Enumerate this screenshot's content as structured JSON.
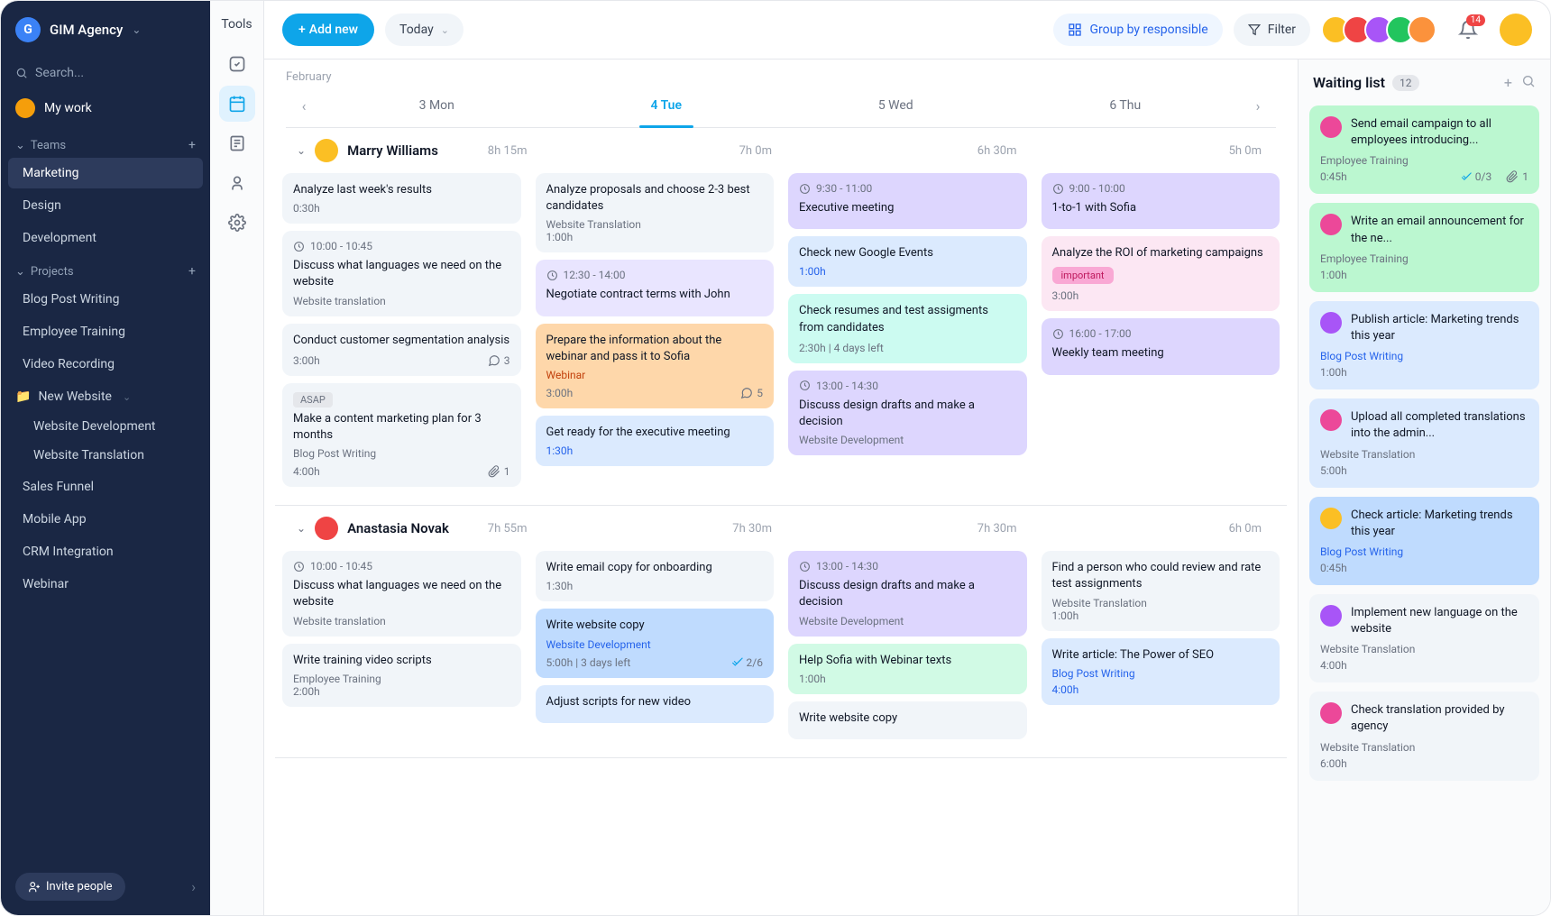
{
  "sidebar": {
    "workspace": "GIM Agency",
    "search_placeholder": "Search...",
    "my_work": "My work",
    "teams_label": "Teams",
    "teams": [
      "Marketing",
      "Design",
      "Development"
    ],
    "projects_label": "Projects",
    "projects_flat": [
      "Blog Post Writing",
      "Employee Training",
      "Video Recording"
    ],
    "project_folder": "New Website",
    "project_sub": [
      "Website Development",
      "Website Translation"
    ],
    "projects_rest": [
      "Sales Funnel",
      "Mobile App",
      "CRM Integration",
      "Webinar"
    ],
    "invite": "Invite people"
  },
  "toolbar": {
    "tools": "Tools",
    "add_new": "Add new",
    "today": "Today",
    "group_by": "Group by responsible",
    "filter": "Filter",
    "notif_count": "14"
  },
  "calendar": {
    "month": "February",
    "days": [
      "3 Mon",
      "4 Tue",
      "5 Wed",
      "6 Thu"
    ],
    "active_index": 1
  },
  "people": [
    {
      "name": "Marry Williams",
      "avatar_color": "#fbbf24",
      "durations": [
        "8h 15m",
        "7h 0m",
        "6h 30m",
        "5h 0m"
      ],
      "cols": [
        [
          {
            "type": "gray",
            "title": "Analyze last week's results",
            "dur": "0:30h"
          },
          {
            "type": "gray",
            "time": "10:00 - 10:45",
            "title": "Discuss what languages we need on the website",
            "proj": "Website translation"
          },
          {
            "type": "gray",
            "title": "Conduct customer segmentation analysis",
            "foot_l": "3:00h",
            "foot_r": "3",
            "foot_icon": "comment"
          },
          {
            "type": "gray",
            "badge": "ASAP",
            "title": "Make a content marketing plan for 3 months",
            "proj": "Blog Post Writing",
            "foot_l": "4:00h",
            "foot_r": "1",
            "foot_icon": "attach"
          }
        ],
        [
          {
            "type": "gray",
            "title": "Analyze proposals and choose 2-3 best candidates",
            "proj": "Website Translation",
            "dur": "1:00h"
          },
          {
            "type": "purple-l",
            "time": "12:30 - 14:00",
            "title": "Negotiate contract terms with John"
          },
          {
            "type": "orange",
            "title": "Prepare the information about the webinar and pass it to Sofia",
            "proj": "Webinar",
            "proj_color": "orange",
            "foot_l": "3:00h",
            "foot_r": "5",
            "foot_icon": "comment"
          },
          {
            "type": "blue-l",
            "title": "Get ready for the executive meeting",
            "dur_blue": "1:30h"
          }
        ],
        [
          {
            "type": "purple",
            "time": "9:30 - 11:00",
            "title": "Executive meeting"
          },
          {
            "type": "blue-l",
            "title": "Check new Google Events",
            "dur_blue": "1:00h"
          },
          {
            "type": "teal",
            "title": "Check resumes and test assigments from candidates",
            "foot_l": "2:30h | 4 days left"
          },
          {
            "type": "purple",
            "time": "13:00 - 14:30",
            "title": "Discuss design drafts and make a decision",
            "proj": "Website Development"
          }
        ],
        [
          {
            "type": "purple",
            "time": "9:00 - 10:00",
            "title": "1-to-1 with Sofia"
          },
          {
            "type": "pink",
            "title": "Analyze the ROI of marketing campaigns",
            "badge_imp": "important",
            "dur": "3:00h"
          },
          {
            "type": "purple",
            "time": "16:00 - 17:00",
            "title": "Weekly team meeting"
          }
        ]
      ]
    },
    {
      "name": "Anastasia Novak",
      "avatar_color": "#ef4444",
      "durations": [
        "7h 55m",
        "7h 30m",
        "7h 30m",
        "6h 0m"
      ],
      "cols": [
        [
          {
            "type": "gray",
            "time": "10:00 - 10:45",
            "title": "Discuss what languages we need on the website",
            "proj": "Website translation"
          },
          {
            "type": "gray",
            "title": "Write training video scripts",
            "proj": "Employee Training",
            "dur": "2:00h"
          }
        ],
        [
          {
            "type": "gray",
            "title": "Write email copy for onboarding",
            "dur": "1:30h"
          },
          {
            "type": "blue",
            "title": "Write website copy",
            "proj": "Website Development",
            "proj_color": "blue",
            "foot_l": "5:00h | 3 days left",
            "foot_r": "2/6",
            "foot_icon": "check"
          },
          {
            "type": "blue-l",
            "title": "Adjust scripts for new video"
          }
        ],
        [
          {
            "type": "purple",
            "time": "13:00 - 14:30",
            "title": "Discuss design drafts and make a decision",
            "proj": "Website Development"
          },
          {
            "type": "teal-l",
            "title": "Help Sofia with Webinar texts",
            "dur": "1:00h"
          },
          {
            "type": "gray",
            "title": "Write website copy"
          }
        ],
        [
          {
            "type": "gray",
            "title": "Find a person who could review and rate test assignments",
            "proj": "Website Translation",
            "dur": "1:00h"
          },
          {
            "type": "blue-l",
            "title": "Write article: The Power of SEO",
            "proj": "Blog Post Writing",
            "proj_color": "blue",
            "dur_blue": "4:00h"
          }
        ]
      ]
    }
  ],
  "waiting": {
    "title": "Waiting list",
    "count": "12",
    "items": [
      {
        "color": "green",
        "av": "#ec4899",
        "title": "Send email campaign to all employees introducing...",
        "proj": "Employee Training",
        "dur": "0:45h",
        "check": "0/3",
        "attach": "1"
      },
      {
        "color": "green",
        "av": "#ec4899",
        "title": "Write an email announcement for the ne...",
        "proj": "Employee Training",
        "dur": "1:00h"
      },
      {
        "color": "blue-l",
        "av": "#a855f7",
        "title": "Publish article: Marketing trends this year",
        "proj": "Blog Post Writing",
        "proj_color": "blue",
        "dur": "1:00h"
      },
      {
        "color": "blue-l",
        "av": "#ec4899",
        "title": "Upload all completed translations into the admin...",
        "proj": "Website Translation",
        "dur": "5:00h"
      },
      {
        "color": "blue",
        "av": "#fbbf24",
        "title": "Check article: Marketing trends this year",
        "proj": "Blog Post Writing",
        "proj_color": "blue",
        "dur": "0:45h"
      },
      {
        "color": "gray",
        "av": "#a855f7",
        "title": "Implement new language on the website",
        "proj": "Website Translation",
        "dur": "4:00h"
      },
      {
        "color": "gray",
        "av": "#ec4899",
        "title": "Check translation provided by agency",
        "proj": "Website Translation",
        "dur": "6:00h"
      }
    ]
  },
  "avatar_colors": [
    "#fbbf24",
    "#ef4444",
    "#a855f7",
    "#22c55e",
    "#fb923c"
  ]
}
